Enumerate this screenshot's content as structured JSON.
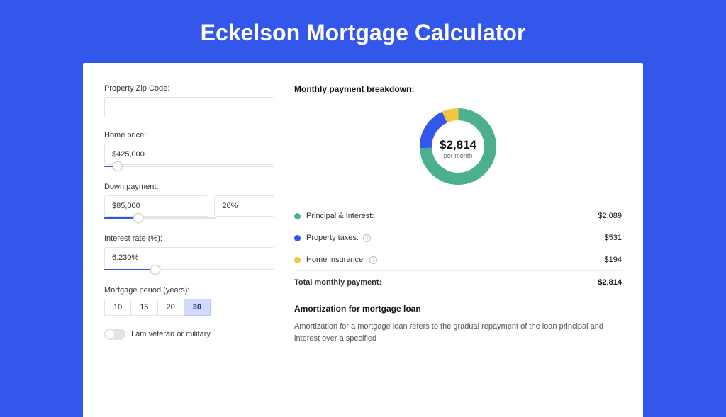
{
  "page_title": "Eckelson Mortgage Calculator",
  "left": {
    "zip_label": "Property Zip Code:",
    "zip_value": "",
    "home_price_label": "Home price:",
    "home_price_value": "$425,000",
    "home_price_slider_pct": 8,
    "down_payment_label": "Down payment:",
    "down_payment_value": "$85,000",
    "down_payment_pct_value": "20%",
    "down_payment_slider_pct": 20,
    "interest_label": "Interest rate (%):",
    "interest_value": "6.230%",
    "interest_slider_pct": 30,
    "period_label": "Mortgage period (years):",
    "periods": [
      "10",
      "15",
      "20",
      "30"
    ],
    "period_active_index": 3,
    "veteran_label": "I am veteran or military",
    "veteran_on": false
  },
  "right": {
    "breakdown_title": "Monthly payment breakdown:",
    "donut_center_amount": "$2,814",
    "donut_center_sub": "per month",
    "rows": [
      {
        "color": "green",
        "label": "Principal & Interest:",
        "has_info": false,
        "value": "$2,089"
      },
      {
        "color": "blue",
        "label": "Property taxes:",
        "has_info": true,
        "value": "$531"
      },
      {
        "color": "yellow",
        "label": "Home insurance:",
        "has_info": true,
        "value": "$194"
      }
    ],
    "total_label": "Total monthly payment:",
    "total_value": "$2,814",
    "amort_title": "Amortization for mortgage loan",
    "amort_text": "Amortization for a mortgage loan refers to the gradual repayment of the loan principal and interest over a specified"
  },
  "chart_data": {
    "type": "pie",
    "title": "Monthly payment breakdown",
    "series": [
      {
        "name": "Principal & Interest",
        "value": 2089,
        "color": "#4caf8f"
      },
      {
        "name": "Property taxes",
        "value": 531,
        "color": "#3356eb"
      },
      {
        "name": "Home insurance",
        "value": 194,
        "color": "#f5c542"
      }
    ],
    "total": 2814,
    "center_label": "$2,814 per month"
  }
}
